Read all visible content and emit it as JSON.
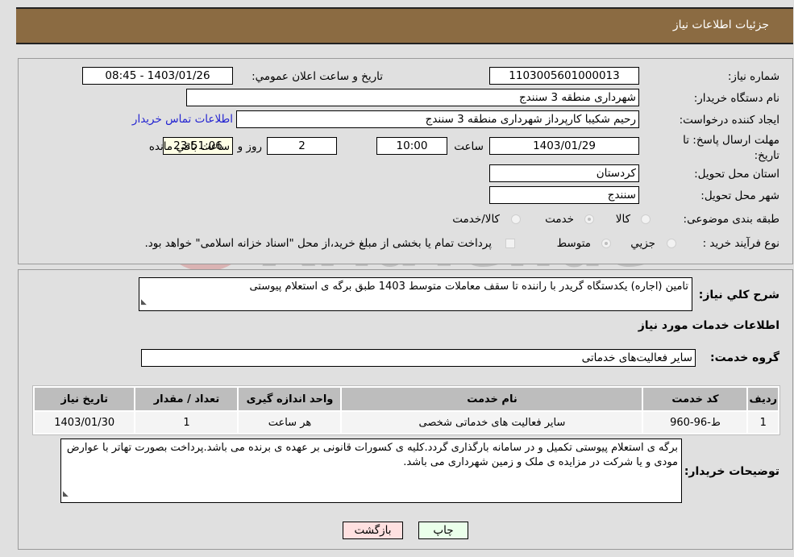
{
  "header": {
    "title": "جزئیات اطلاعات نیاز"
  },
  "form": {
    "need_number_label": "شماره نیاز:",
    "need_number": "1103005601000013",
    "announce_label": "تاريخ و ساعت اعلان عمومي:",
    "announce_value": "1403/01/26 - 08:45",
    "buyer_org_label": "نام دستگاه خريدار:",
    "buyer_org": "شهرداری منطقه 3 سنندج",
    "creator_label": "ايجاد کننده درخواست:",
    "creator": "رحیم شکیبا کارپرداز شهرداری منطقه 3 سنندج",
    "contact_link": "اطلاعات تماس خريدار",
    "deadline_label": "مهلت ارسال پاسخ: تا تاريخ:",
    "deadline_date": "1403/01/29",
    "time_label": "ساعت",
    "deadline_time": "10:00",
    "days_value": "2",
    "days_label": "روز و",
    "remaining_time": "23:51:06",
    "remaining_label": "ساعت باقي مانده",
    "province_label": "استان محل تحويل:",
    "province": "کردستان",
    "city_label": "شهر محل تحويل:",
    "city": "سنندج",
    "category_label": "طبقه بندی موضوعی:",
    "category_options": [
      "کالا",
      "خدمت",
      "کالا/خدمت"
    ],
    "category_selected": "خدمت",
    "process_label": "نوع فرآيند خريد :",
    "process_options": [
      "جزيي",
      "متوسط"
    ],
    "process_selected": "متوسط",
    "treasury_text": "پرداخت تمام يا بخشی از مبلغ خريد،از محل \"اسناد خزانه اسلامی\" خواهد بود."
  },
  "details": {
    "summary_label": "شرح کلي نياز:",
    "summary": "تامین (اجاره) یکدستگاه گریدر با راننده تا سقف معاملات متوسط 1403 طبق برگه ی استعلام پیوستی",
    "services_heading": "اطلاعات خدمات مورد نياز",
    "group_label": "گروه خدمت:",
    "group_value": "سایر فعالیت‌های خدماتی",
    "table": {
      "headers": [
        "رديف",
        "کد خدمت",
        "نام خدمت",
        "واحد اندازه گيری",
        "تعداد / مقدار",
        "تاريخ نياز"
      ],
      "rows": [
        [
          "1",
          "ط-96-960",
          "سایر فعالیت های خدماتی شخصی",
          "هر ساعت",
          "1",
          "1403/01/30"
        ]
      ]
    },
    "buyer_notes_label": "توضيحات خريدار:",
    "buyer_notes": "برگه ی استعلام پیوستی تکمیل و در سامانه بارگذاری گردد.کلیه ی کسورات قانونی بر عهده ی برنده می باشد.پرداخت بصورت تهاتر با عوارض مودی و یا شرکت در مزایده ی ملک و زمین شهرداری می باشد."
  },
  "buttons": {
    "print": "چاپ",
    "back": "بازگشت"
  },
  "colors": {
    "header_bg": "#8b6b42",
    "link": "#2323d1",
    "print_bg": "#eaffea",
    "back_bg": "#ffe0e0"
  }
}
